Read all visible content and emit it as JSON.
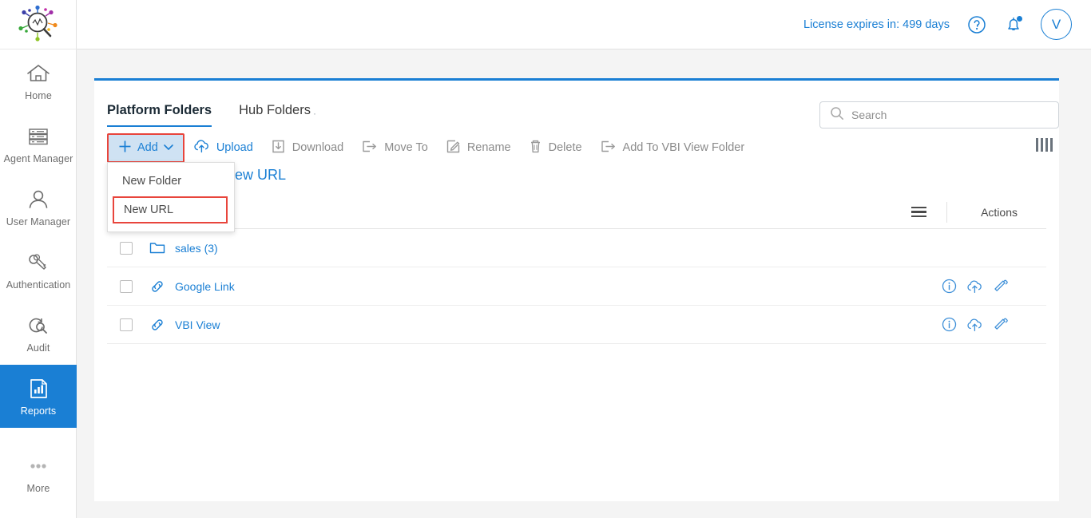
{
  "brand": {
    "logo_name": "magnifier-network-logo",
    "accent": "#1a7fd4",
    "highlight": "#e8453c"
  },
  "sidebar": {
    "items": [
      {
        "label": "Home",
        "icon": "home-icon",
        "active": false
      },
      {
        "label": "Agent Manager",
        "icon": "server-stack-icon",
        "active": false
      },
      {
        "label": "User Manager",
        "icon": "user-icon",
        "active": false
      },
      {
        "label": "Authentication",
        "icon": "keys-icon",
        "active": false
      },
      {
        "label": "Audit",
        "icon": "audit-search-icon",
        "active": false
      },
      {
        "label": "Reports",
        "icon": "report-chart-icon",
        "active": true
      },
      {
        "label": "More",
        "icon": "ellipsis-icon",
        "active": false
      }
    ]
  },
  "topbar": {
    "license_text": "License expires in: 499 days",
    "help_icon": "question-circle-icon",
    "notification_icon": "bell-icon",
    "avatar_initial": "V"
  },
  "tabs": [
    {
      "label": "Platform Folders",
      "active": true
    },
    {
      "label": "Hub Folders",
      "active": false
    }
  ],
  "search": {
    "placeholder": "Search",
    "value": "",
    "icon": "search-icon"
  },
  "toolbar": {
    "add_label": "Add",
    "add_icon": "plus-icon",
    "add_caret": "chevron-down-icon",
    "items": [
      {
        "label": "Upload",
        "icon": "cloud-upload-icon"
      },
      {
        "label": "Download",
        "icon": "download-box-icon"
      },
      {
        "label": "Move To",
        "icon": "move-to-icon"
      },
      {
        "label": "Rename",
        "icon": "pencil-square-icon"
      },
      {
        "label": "Delete",
        "icon": "trash-icon"
      },
      {
        "label": "Add To VBI View Folder",
        "icon": "add-to-folder-icon"
      }
    ],
    "column_toggle_icon": "columns-icon"
  },
  "dropdown": {
    "open": true,
    "items": [
      {
        "label": "New Folder",
        "highlighted": false
      },
      {
        "label": "New URL",
        "highlighted": true
      }
    ]
  },
  "breadcrumb": {
    "text": "Platform Folders / New URL"
  },
  "table": {
    "menu_icon": "list-menu-icon",
    "actions_header": "Actions",
    "rows": [
      {
        "name": "sales (3)",
        "icon": "folder-icon",
        "checked": false,
        "actions": []
      },
      {
        "name": "Google Link",
        "icon": "link-icon",
        "checked": false,
        "actions": [
          "info-icon",
          "cloud-upload-icon",
          "pencil-icon"
        ]
      },
      {
        "name": "VBI View",
        "icon": "link-icon",
        "checked": false,
        "actions": [
          "info-icon",
          "cloud-upload-icon",
          "pencil-icon"
        ]
      }
    ]
  }
}
